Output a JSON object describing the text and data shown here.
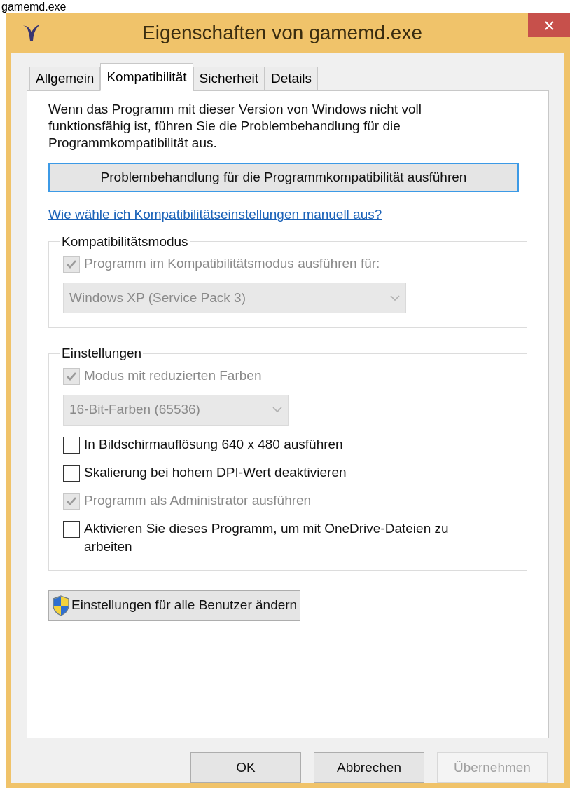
{
  "caption": "gamemd.exe",
  "window": {
    "title": "Eigenschaften von gamemd.exe"
  },
  "tabs": [
    {
      "label": "Allgemein",
      "selected": false
    },
    {
      "label": "Kompatibilität",
      "selected": true
    },
    {
      "label": "Sicherheit",
      "selected": false
    },
    {
      "label": "Details",
      "selected": false
    }
  ],
  "intro": "Wenn das Programm mit dieser Version von Windows nicht voll funktionsfähig ist, führen Sie die Problembehandlung für die Programmkompatibilität aus.",
  "troubleshoot_button": "Problembehandlung für die Programmkompatibilität ausführen",
  "help_link": "Wie wähle ich Kompatibilitätseinstellungen manuell aus?",
  "groups": [
    {
      "title": "Kompatibilitätsmodus",
      "items": [
        {
          "kind": "checkbox",
          "label": "Programm im Kompatibilitätsmodus ausführen für:",
          "checked": true,
          "disabled": true
        },
        {
          "kind": "dropdown",
          "value": "Windows XP (Service Pack 3)",
          "disabled": true,
          "wide": true
        }
      ]
    },
    {
      "title": "Einstellungen",
      "items": [
        {
          "kind": "checkbox",
          "label": "Modus mit reduzierten Farben",
          "checked": true,
          "disabled": true
        },
        {
          "kind": "dropdown",
          "value": "16-Bit-Farben (65536)",
          "disabled": true,
          "wide": false
        },
        {
          "kind": "checkbox",
          "label": "In Bildschirmauflösung 640 x 480 ausführen",
          "checked": false,
          "disabled": false
        },
        {
          "kind": "checkbox",
          "label": "Skalierung bei hohem DPI-Wert deaktivieren",
          "checked": false,
          "disabled": false
        },
        {
          "kind": "checkbox",
          "label": "Programm als Administrator ausführen",
          "checked": true,
          "disabled": true
        },
        {
          "kind": "checkbox",
          "label": "Aktivieren Sie dieses Programm, um mit OneDrive-Dateien zu arbeiten",
          "checked": false,
          "disabled": false
        }
      ]
    }
  ],
  "all_users_button": "Einstellungen für alle Benutzer ändern",
  "buttons": [
    {
      "label": "OK",
      "disabled": false
    },
    {
      "label": "Abbrechen",
      "disabled": false
    },
    {
      "label": "Übernehmen",
      "disabled": true
    }
  ]
}
